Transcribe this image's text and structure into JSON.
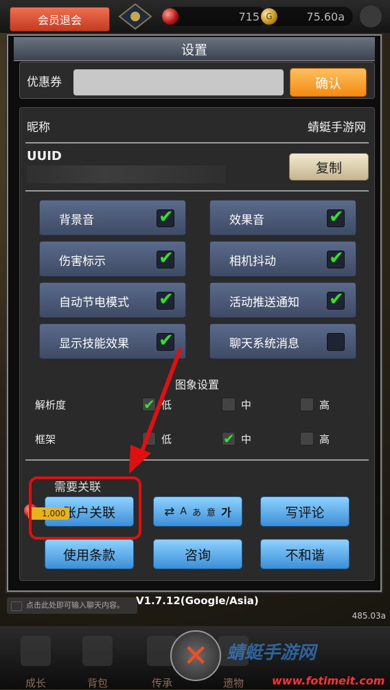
{
  "topbar": {
    "member_button": "会员退会",
    "gem_value": "715",
    "gold_value": "75.60a"
  },
  "dialog": {
    "title": "设置",
    "coupon": {
      "label": "优惠券",
      "placeholder": "",
      "confirm": "确认"
    },
    "nickname": {
      "label": "昵称",
      "value": "蜻蜓手游网"
    },
    "uuid": {
      "label": "UUID",
      "copy": "复制"
    },
    "toggles": [
      {
        "label": "背景音",
        "checked": true
      },
      {
        "label": "效果音",
        "checked": true
      },
      {
        "label": "伤害标示",
        "checked": true
      },
      {
        "label": "相机抖动",
        "checked": true
      },
      {
        "label": "自动节电模式",
        "checked": true
      },
      {
        "label": "活动推送通知",
        "checked": true
      },
      {
        "label": "显示技能效果",
        "checked": true
      },
      {
        "label": "聊天系统消息",
        "checked": false
      }
    ],
    "graphics": {
      "title": "图象设置",
      "resolution": {
        "label": "解析度",
        "options": [
          "低",
          "中",
          "高"
        ],
        "selected": "低"
      },
      "frame": {
        "label": "框架",
        "options": [
          "低",
          "中",
          "高"
        ],
        "selected": "中"
      }
    },
    "account": {
      "need_link": "需要关联",
      "link_button": "账户关联",
      "reward": "1,000",
      "write_review": "写评论",
      "terms": "使用条款",
      "consult": "咨询",
      "report": "不和谐",
      "lang_glyphs": {
        "a": "A",
        "b": "あ",
        "c": "意",
        "d": "가"
      }
    }
  },
  "chat_hint": "点击此处即可输入聊天内容。",
  "version": "V1.7.12(Google/Asia)",
  "power": "485.03a",
  "nav": [
    "成长",
    "背包",
    "传承",
    "遗物"
  ],
  "watermark": {
    "logo": "蜻蜓手游网",
    "url": "www.fotimeit.com"
  },
  "colors": {
    "confirm": "#f28a10",
    "toggle": "#4a5a7a",
    "check": "#31e22a",
    "highlight": "#e01010"
  }
}
